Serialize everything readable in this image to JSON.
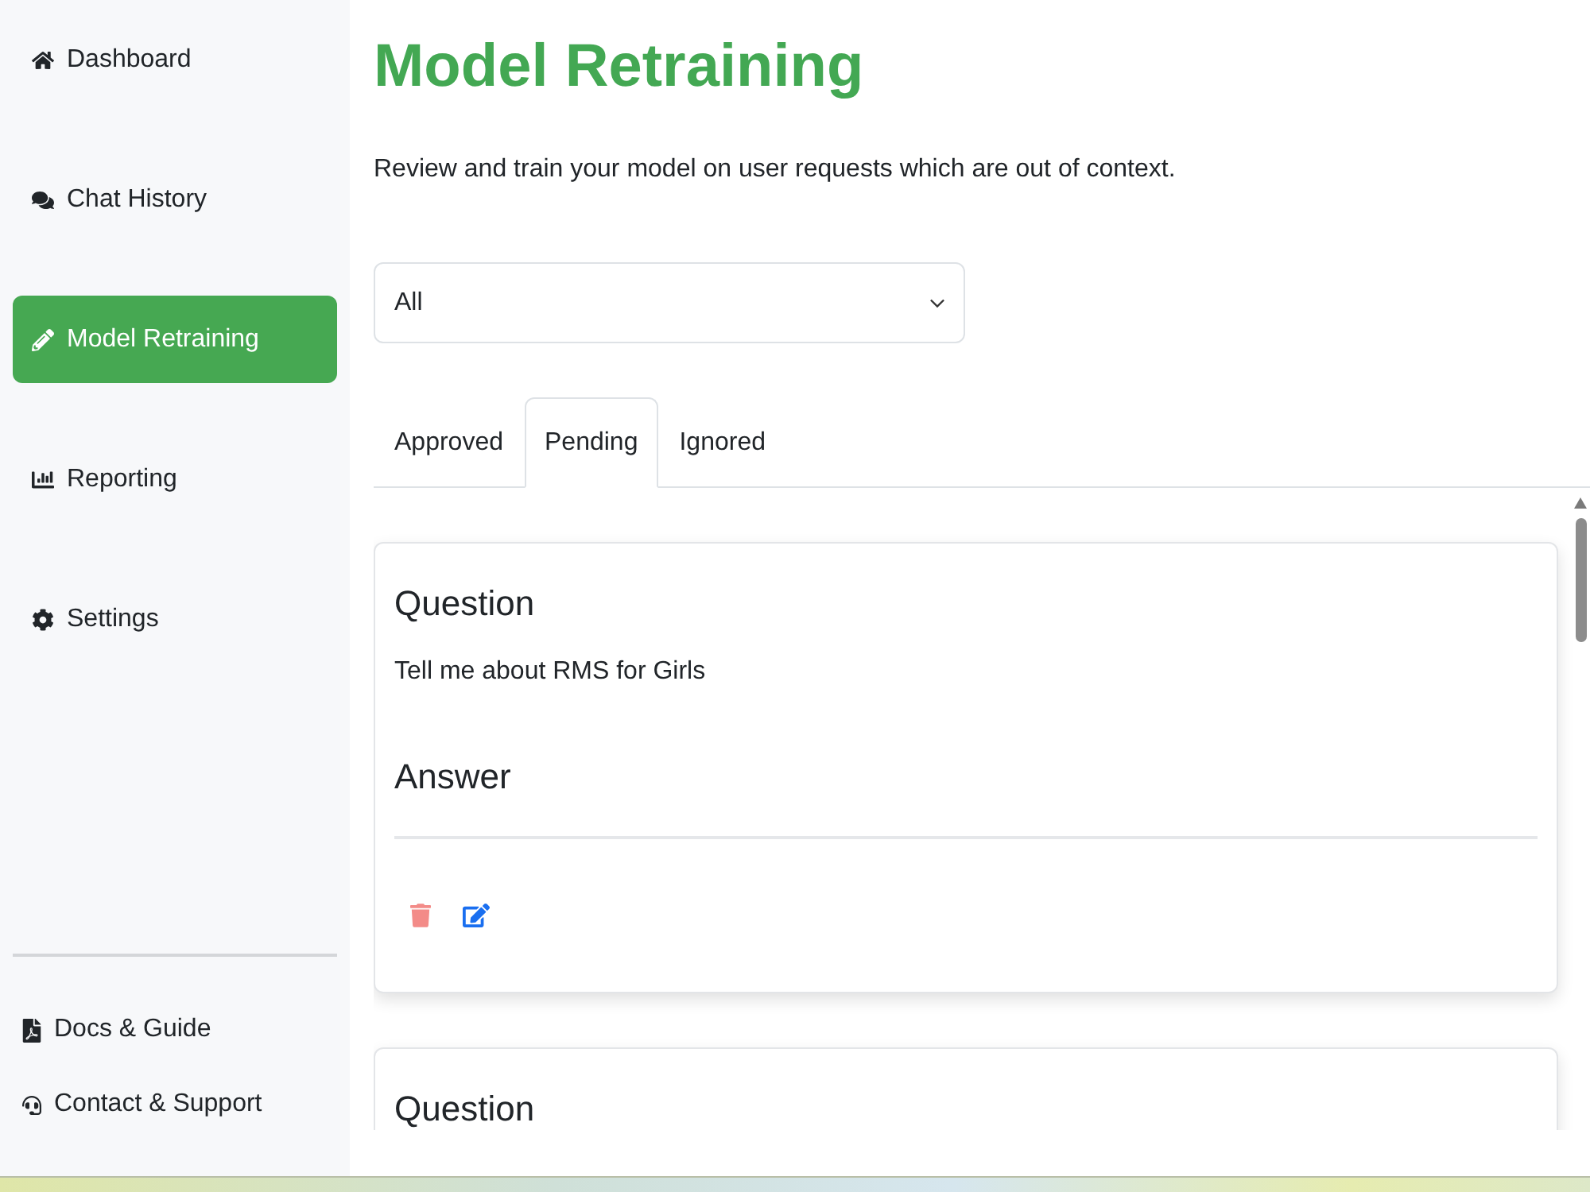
{
  "sidebar": {
    "items": [
      {
        "label": "Dashboard",
        "selected": false
      },
      {
        "label": "Chat History",
        "selected": false
      },
      {
        "label": "Model Retraining",
        "selected": true
      },
      {
        "label": "Reporting",
        "selected": false
      },
      {
        "label": "Settings",
        "selected": false
      }
    ],
    "footer_links": [
      {
        "label": "Docs & Guide"
      },
      {
        "label": "Contact & Support"
      }
    ]
  },
  "page": {
    "title": "Model Retraining",
    "subtitle": "Review and train your model on user requests which are out of context."
  },
  "filter": {
    "value": "All"
  },
  "tabs": [
    {
      "label": "Approved",
      "selected": false
    },
    {
      "label": "Pending",
      "selected": true
    },
    {
      "label": "Ignored",
      "selected": false
    }
  ],
  "cards": [
    {
      "question_heading": "Question",
      "question": "Tell me about RMS for Girls",
      "answer_heading": "Answer"
    },
    {
      "question_heading": "Question"
    }
  ]
}
